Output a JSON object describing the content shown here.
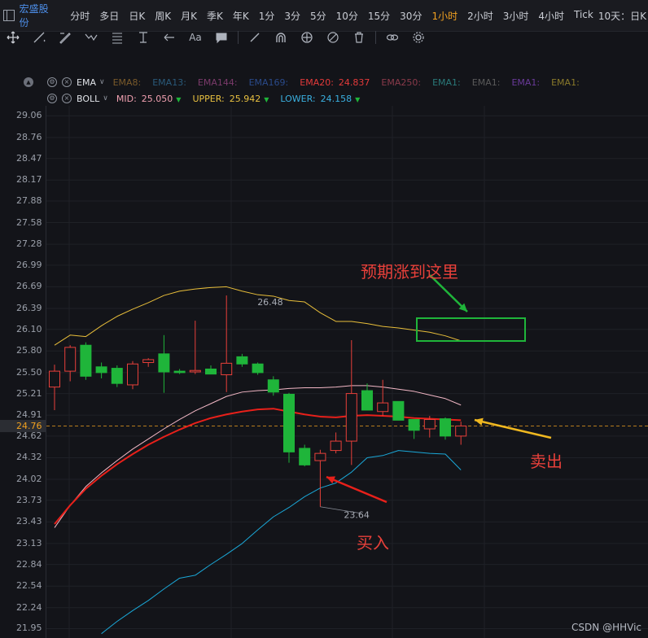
{
  "toolbar": {
    "stock_name": "宏盛股份",
    "timeframes": [
      "分时",
      "多日",
      "日K",
      "周K",
      "月K",
      "季K",
      "年K",
      "1分",
      "3分",
      "5分",
      "10分",
      "15分",
      "30分",
      "1小时",
      "2小时",
      "3小时",
      "4小时",
      "Tick"
    ],
    "active_timeframe": "1小时",
    "tail_label": "10天：日K"
  },
  "drawing_tools": [
    "move-icon",
    "line-icon",
    "pen-icon",
    "zigzag-icon",
    "fib-icon",
    "text-position-icon",
    "arrow-icon",
    "text-aa-icon",
    "comment-icon",
    "ruler-icon",
    "magnet-icon",
    "lock-drawing-icon",
    "hide-icon",
    "trash-icon",
    "link-icon",
    "settings-icon"
  ],
  "indicators": {
    "ema": {
      "name": "EMA",
      "items": [
        {
          "label": "EMA8:",
          "value": "",
          "color": "#7a5a2a"
        },
        {
          "label": "EMA13:",
          "value": "",
          "color": "#2a5a7a"
        },
        {
          "label": "EMA144:",
          "value": "",
          "color": "#7a3a6a"
        },
        {
          "label": "EMA169:",
          "value": "",
          "color": "#2a4a8a"
        },
        {
          "label": "EMA20:",
          "value": "24.837",
          "color": "#e43a3a"
        },
        {
          "label": "EMA250:",
          "value": "",
          "color": "#8a3a4a"
        },
        {
          "label": "EMA1:",
          "value": "",
          "color": "#2a7a7a"
        },
        {
          "label": "EMA1:",
          "value": "",
          "color": "#5a5a5a"
        },
        {
          "label": "EMA1:",
          "value": "",
          "color": "#6a3a9a"
        },
        {
          "label": "EMA1:",
          "value": "",
          "color": "#8a7a2a"
        }
      ]
    },
    "boll": {
      "name": "BOLL",
      "items": [
        {
          "label": "MID:",
          "value": "25.050",
          "color": "#f0a0b0"
        },
        {
          "label": "UPPER:",
          "value": "25.942",
          "color": "#e8c040"
        },
        {
          "label": "LOWER:",
          "value": "24.158",
          "color": "#3ab0e0"
        }
      ]
    }
  },
  "colors": {
    "up": "#e8403a",
    "down": "#1fb53a",
    "ema20": "#e8201a",
    "boll_mid": "#f3b8c6",
    "boll_upper": "#e8be3a",
    "boll_lower": "#1aa8d8",
    "current_price": "#f0a020"
  },
  "current_price": "24.76",
  "chart_data": {
    "type": "candlestick",
    "y_ticks": [
      29.06,
      28.76,
      28.47,
      28.17,
      27.88,
      27.58,
      27.28,
      26.99,
      26.69,
      26.39,
      26.1,
      25.8,
      25.5,
      25.21,
      24.91,
      24.62,
      24.32,
      24.02,
      23.73,
      23.43,
      23.13,
      22.84,
      22.54,
      22.24,
      21.95
    ],
    "ylim": [
      21.82,
      29.2
    ],
    "candles": [
      {
        "o": 25.3,
        "h": 25.61,
        "l": 24.98,
        "c": 25.52
      },
      {
        "o": 25.52,
        "h": 25.88,
        "l": 25.38,
        "c": 25.85
      },
      {
        "o": 25.88,
        "h": 25.92,
        "l": 25.4,
        "c": 25.45
      },
      {
        "o": 25.58,
        "h": 25.64,
        "l": 25.42,
        "c": 25.5
      },
      {
        "o": 25.56,
        "h": 25.6,
        "l": 25.3,
        "c": 25.35
      },
      {
        "o": 25.33,
        "h": 25.66,
        "l": 25.27,
        "c": 25.62
      },
      {
        "o": 25.64,
        "h": 25.7,
        "l": 25.58,
        "c": 25.68
      },
      {
        "o": 25.76,
        "h": 26.02,
        "l": 25.22,
        "c": 25.51
      },
      {
        "o": 25.52,
        "h": 25.55,
        "l": 25.48,
        "c": 25.5
      },
      {
        "o": 25.51,
        "h": 26.22,
        "l": 25.48,
        "c": 25.53
      },
      {
        "o": 25.55,
        "h": 25.6,
        "l": 25.48,
        "c": 25.48
      },
      {
        "o": 25.47,
        "h": 26.57,
        "l": 25.23,
        "c": 25.63
      },
      {
        "o": 25.72,
        "h": 25.76,
        "l": 25.58,
        "c": 25.62
      },
      {
        "o": 25.62,
        "h": 25.64,
        "l": 25.47,
        "c": 25.5
      },
      {
        "o": 25.4,
        "h": 25.45,
        "l": 25.18,
        "c": 25.23
      },
      {
        "o": 25.2,
        "h": 25.22,
        "l": 24.25,
        "c": 24.4
      },
      {
        "o": 24.45,
        "h": 24.5,
        "l": 24.2,
        "c": 24.22
      },
      {
        "o": 24.28,
        "h": 24.43,
        "l": 23.64,
        "c": 24.38
      },
      {
        "o": 24.42,
        "h": 24.67,
        "l": 24.38,
        "c": 24.55
      },
      {
        "o": 24.55,
        "h": 25.95,
        "l": 24.22,
        "c": 25.21
      },
      {
        "o": 25.25,
        "h": 25.35,
        "l": 24.98,
        "c": 24.98
      },
      {
        "o": 24.96,
        "h": 25.4,
        "l": 24.9,
        "c": 25.08
      },
      {
        "o": 25.1,
        "h": 25.1,
        "l": 24.84,
        "c": 24.84
      },
      {
        "o": 24.85,
        "h": 24.85,
        "l": 24.58,
        "c": 24.7
      },
      {
        "o": 24.72,
        "h": 24.9,
        "l": 24.6,
        "c": 24.85
      },
      {
        "o": 24.86,
        "h": 24.88,
        "l": 24.57,
        "c": 24.62
      },
      {
        "o": 24.62,
        "h": 24.82,
        "l": 24.5,
        "c": 24.76
      }
    ],
    "ema20": [
      23.4,
      23.66,
      23.89,
      24.07,
      24.23,
      24.37,
      24.5,
      24.61,
      24.71,
      24.8,
      24.87,
      24.92,
      24.96,
      24.99,
      25.0,
      24.96,
      24.92,
      24.89,
      24.88,
      24.9,
      24.91,
      24.9,
      24.89,
      24.87,
      24.86,
      24.85,
      24.84
    ],
    "boll_mid": [
      23.35,
      23.66,
      23.92,
      24.11,
      24.28,
      24.44,
      24.58,
      24.72,
      24.85,
      24.97,
      25.07,
      25.17,
      25.23,
      25.25,
      25.26,
      25.28,
      25.29,
      25.29,
      25.3,
      25.32,
      25.32,
      25.3,
      25.27,
      25.24,
      25.19,
      25.14,
      25.05
    ],
    "boll_upper": [
      25.88,
      26.02,
      26.0,
      26.15,
      26.28,
      26.38,
      26.47,
      26.57,
      26.63,
      26.66,
      26.68,
      26.69,
      26.63,
      26.58,
      26.56,
      26.5,
      26.48,
      26.33,
      26.21,
      26.21,
      26.18,
      26.14,
      26.12,
      26.09,
      26.06,
      26.01,
      25.94
    ],
    "boll_lower": [
      null,
      null,
      null,
      21.88,
      22.05,
      22.2,
      22.34,
      22.5,
      22.65,
      22.69,
      22.84,
      22.98,
      23.13,
      23.32,
      23.5,
      23.63,
      23.78,
      23.9,
      23.97,
      24.12,
      24.32,
      24.35,
      24.42,
      24.4,
      24.38,
      24.37,
      24.15
    ],
    "point_labels": {
      "high": "26.48",
      "low": "23.64"
    }
  },
  "annotations": {
    "expect_text": "预期涨到这里",
    "buy_text": "买入",
    "sell_text": "卖出"
  },
  "watermark": "CSDN @HHVic"
}
